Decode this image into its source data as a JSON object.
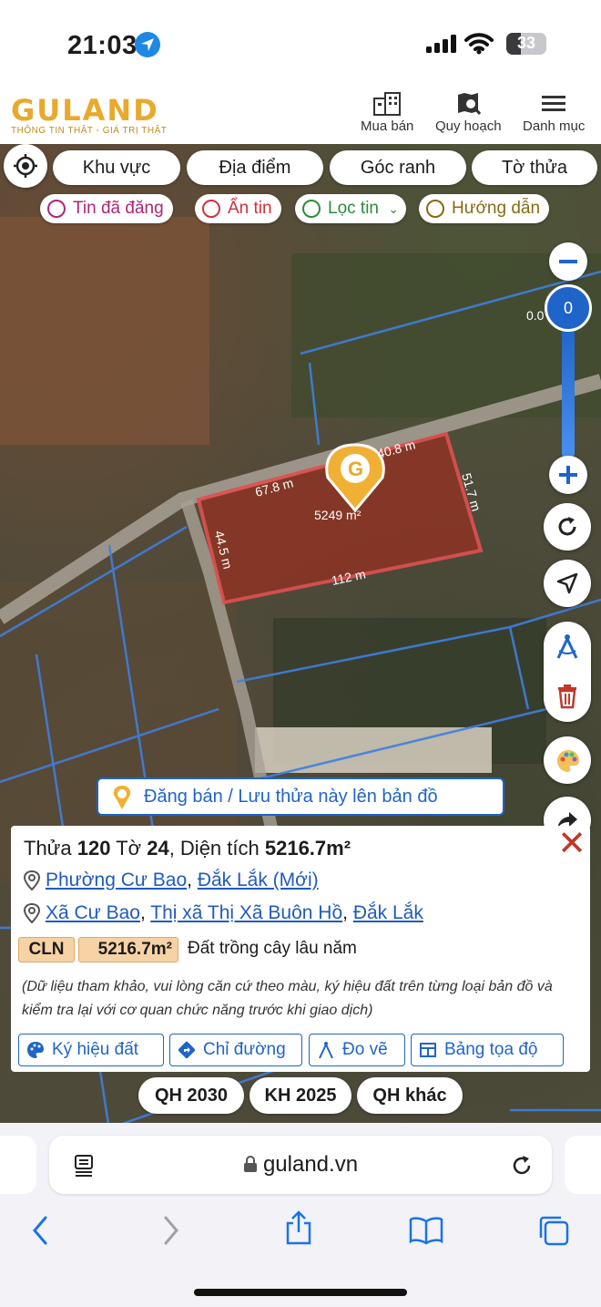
{
  "status_bar": {
    "time": "21:03",
    "battery": "33"
  },
  "header": {
    "logo": "GULAND",
    "tagline": "THÔNG TIN THẬT - GIÁ TRỊ THẬT",
    "nav": [
      {
        "label": "Mua bán",
        "icon": "buildings-icon"
      },
      {
        "label": "Quy hoạch",
        "icon": "map-search-icon"
      },
      {
        "label": "Danh mục",
        "icon": "menu-icon"
      }
    ]
  },
  "filters": [
    "Khu vực",
    "Địa điểm",
    "Góc ranh",
    "Tờ thửa"
  ],
  "chips": [
    {
      "label": "Tin đã đăng",
      "color": "#b0247a"
    },
    {
      "label": "Ẩn tin",
      "color": "#d0323a"
    },
    {
      "label": "Lọc tin",
      "color": "#2e8b3a"
    },
    {
      "label": "Hướng dẫn",
      "color": "#8a6a10"
    }
  ],
  "zoom": {
    "value": "0",
    "opacity_label": "0.0"
  },
  "parcel": {
    "area_label": "5249 m²",
    "edges": [
      "67.8 m",
      "40.8 m",
      "51.7 m",
      "112 m",
      "44.5 m"
    ]
  },
  "banner": "Đăng bán / Lưu thửa này lên bản đồ",
  "card": {
    "title_prefix": "Thửa",
    "parcel_no": "120",
    "sheet_prefix": "Tờ",
    "sheet_no": "24",
    "area_prefix": ", Diện tích",
    "area": "5216.7m²",
    "address_new": {
      "ward": "Phường Cư Bao",
      "province": "Đắk Lắk (Mới)"
    },
    "address_old": {
      "commune": "Xã Cư Bao",
      "town": "Thị xã Thị Xã Buôn Hồ",
      "province": "Đắk Lắk"
    },
    "land_code": "CLN",
    "land_area": "5216.7m²",
    "land_type": "Đất trồng cây lâu năm",
    "disclaimer": "(Dữ liệu tham khảo, vui lòng căn cứ theo màu, ký hiệu đất trên từng loại bản đồ và kiểm tra lại với cơ quan chức năng trước khi giao dịch)",
    "actions": [
      "Ký hiệu đất",
      "Chỉ đường",
      "Đo vẽ",
      "Bảng tọa độ"
    ]
  },
  "plans": [
    "QH 2030",
    "KH 2025",
    "QH khác"
  ],
  "browser": {
    "url": "guland.vn"
  }
}
